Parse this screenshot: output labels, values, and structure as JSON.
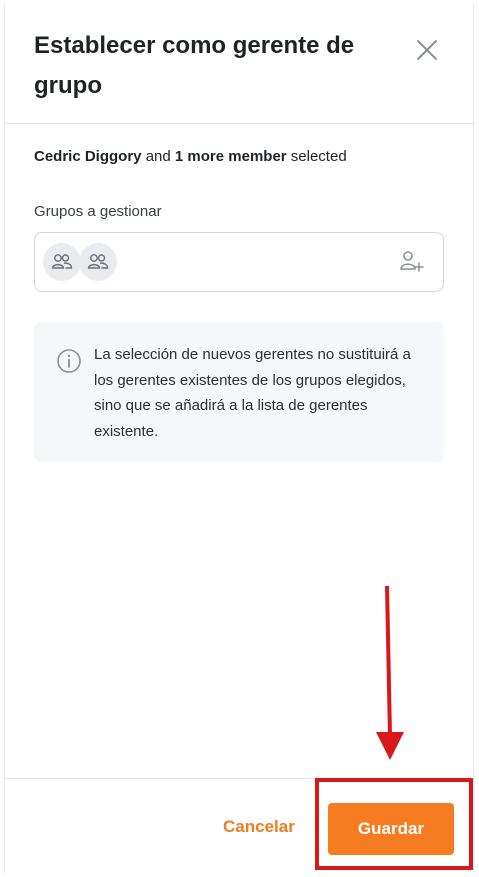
{
  "dialog": {
    "title": "Establecer como gerente de grupo",
    "close_icon": "close-icon"
  },
  "selection": {
    "name": "Cedric Diggory",
    "connector": " and ",
    "count_text": "1 more member",
    "suffix": " selected"
  },
  "groups_field": {
    "label": "Grupos a gestionar",
    "selected_group_icons": [
      "group-icon",
      "group-icon"
    ],
    "add_icon": "add-user-icon"
  },
  "info": {
    "icon": "info-icon",
    "text": "La selección de nuevos gerentes no sustituirá a los gerentes existentes de los grupos elegidos, sino que se añadirá a la lista de gerentes existente."
  },
  "footer": {
    "cancel_label": "Cancelar",
    "save_label": "Guardar"
  },
  "colors": {
    "accent": "#f57c20",
    "annotation": "#d7191c",
    "info_bg": "#f5f7fa"
  }
}
